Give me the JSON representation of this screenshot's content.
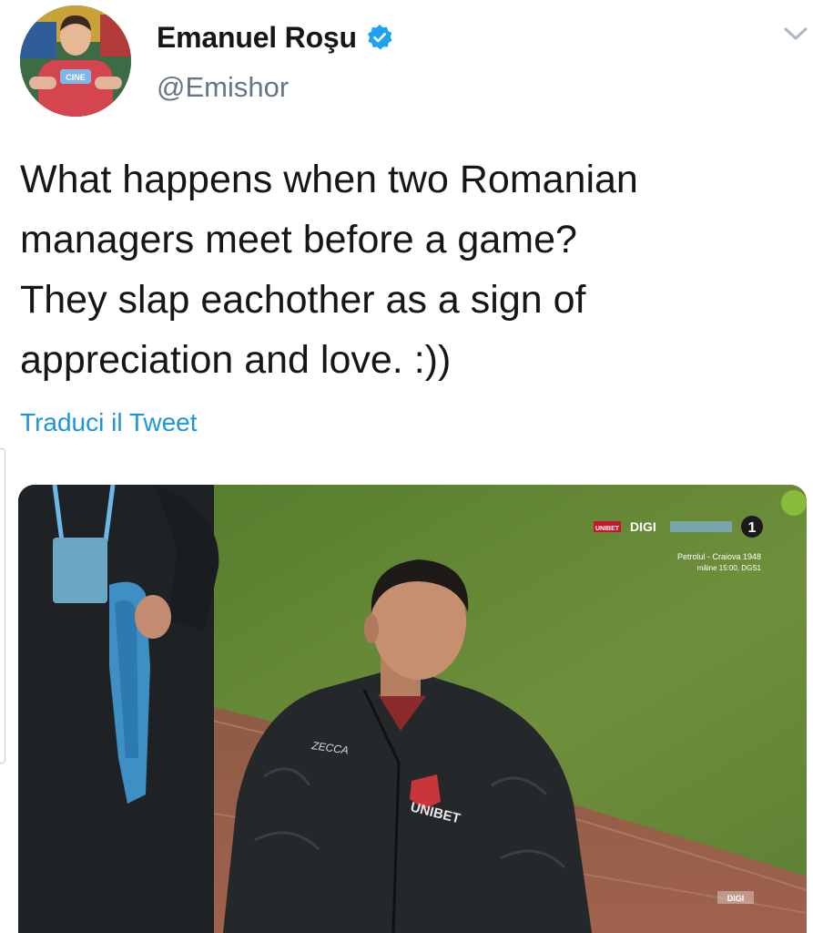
{
  "tweet": {
    "author": {
      "display_name": "Emanuel Roşu",
      "handle": "@Emishor",
      "verified": true,
      "avatar_icon": "profile-photo",
      "avatar_shirt_text": "CINE"
    },
    "text_lines": [
      "What happens when two Romanian",
      "managers meet before a game?",
      "They slap eachother as a sign of",
      "appreciation and love. :))"
    ],
    "translate_label": "Traduci il Tweet",
    "menu_icon": "chevron-down-icon"
  },
  "media": {
    "broadcaster": "DIGI",
    "broadcaster_badge": "UNIBET",
    "channel_number": "1",
    "ticker_line1": "Petrolul - Craiova 1948",
    "ticker_line2": "mâine 15:00, DGS1",
    "jacket_sponsor": "UNIBET",
    "jacket_brand": "ZECCA",
    "watermark": "DIGI"
  },
  "colors": {
    "link_blue": "#1b95e0",
    "verified_blue": "#1da1f2",
    "secondary_text": "#657786",
    "primary_text": "#14171a"
  }
}
